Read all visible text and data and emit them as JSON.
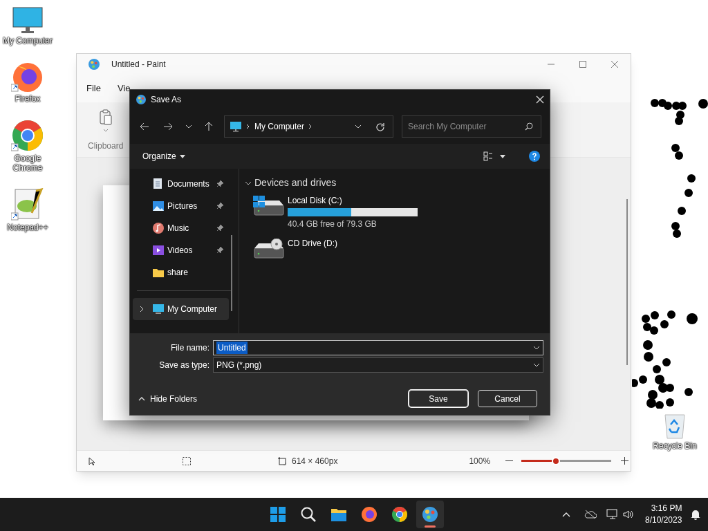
{
  "desktop_icons": [
    {
      "label": "My Computer",
      "kind": "monitor"
    },
    {
      "label": "Firefox",
      "kind": "firefox"
    },
    {
      "label": "Google Chrome",
      "kind": "chrome"
    },
    {
      "label": "Notepad++",
      "kind": "notepad"
    },
    {
      "label": "Recycle Bin",
      "kind": "bin"
    }
  ],
  "paint": {
    "title": "Untitled - Paint",
    "menu": [
      "File",
      "Vie"
    ],
    "ribbon_group": "Clipboard",
    "status": {
      "canvas_size": "614 × 460px",
      "zoom": "100%",
      "zoom_slider": {
        "level": 0.38
      }
    }
  },
  "dialog": {
    "title": "Save As",
    "address": "My Computer",
    "search": {
      "placeholder": "Search My Computer"
    },
    "organize": "Organize",
    "nav_items": [
      {
        "label": "Documents",
        "kind": "documents",
        "pinned": true,
        "selected": false
      },
      {
        "label": "Pictures",
        "kind": "pictures",
        "pinned": true,
        "selected": false
      },
      {
        "label": "Music",
        "kind": "music",
        "pinned": true,
        "selected": false
      },
      {
        "label": "Videos",
        "kind": "videos",
        "pinned": true,
        "selected": false
      },
      {
        "label": "share",
        "kind": "folder",
        "pinned": false,
        "selected": false
      },
      {
        "label": "My Computer",
        "kind": "computer",
        "pinned": false,
        "selected": true
      }
    ],
    "section": "Devices and drives",
    "drives": [
      {
        "name": "Local Disk (C:)",
        "kind": "system",
        "level": 0.49,
        "free": "40.4 GB free of 79.3 GB"
      },
      {
        "name": "CD Drive (D:)",
        "kind": "cd"
      }
    ],
    "file_name_label": "File name:",
    "file_name": "Untitled",
    "type_label": "Save as type:",
    "type": "PNG (*.png)",
    "hide_folders": "Hide Folders",
    "buttons": [
      "Save",
      "Cancel"
    ]
  },
  "taskbar": {
    "apps": [
      {
        "kind": "start",
        "active": false
      },
      {
        "kind": "search",
        "active": false
      },
      {
        "kind": "files",
        "active": false
      },
      {
        "kind": "firefox",
        "active": false
      },
      {
        "kind": "chrome",
        "active": false
      },
      {
        "kind": "paint",
        "active": true
      }
    ],
    "time": "3:16 PM",
    "date": "8/10/2023"
  }
}
